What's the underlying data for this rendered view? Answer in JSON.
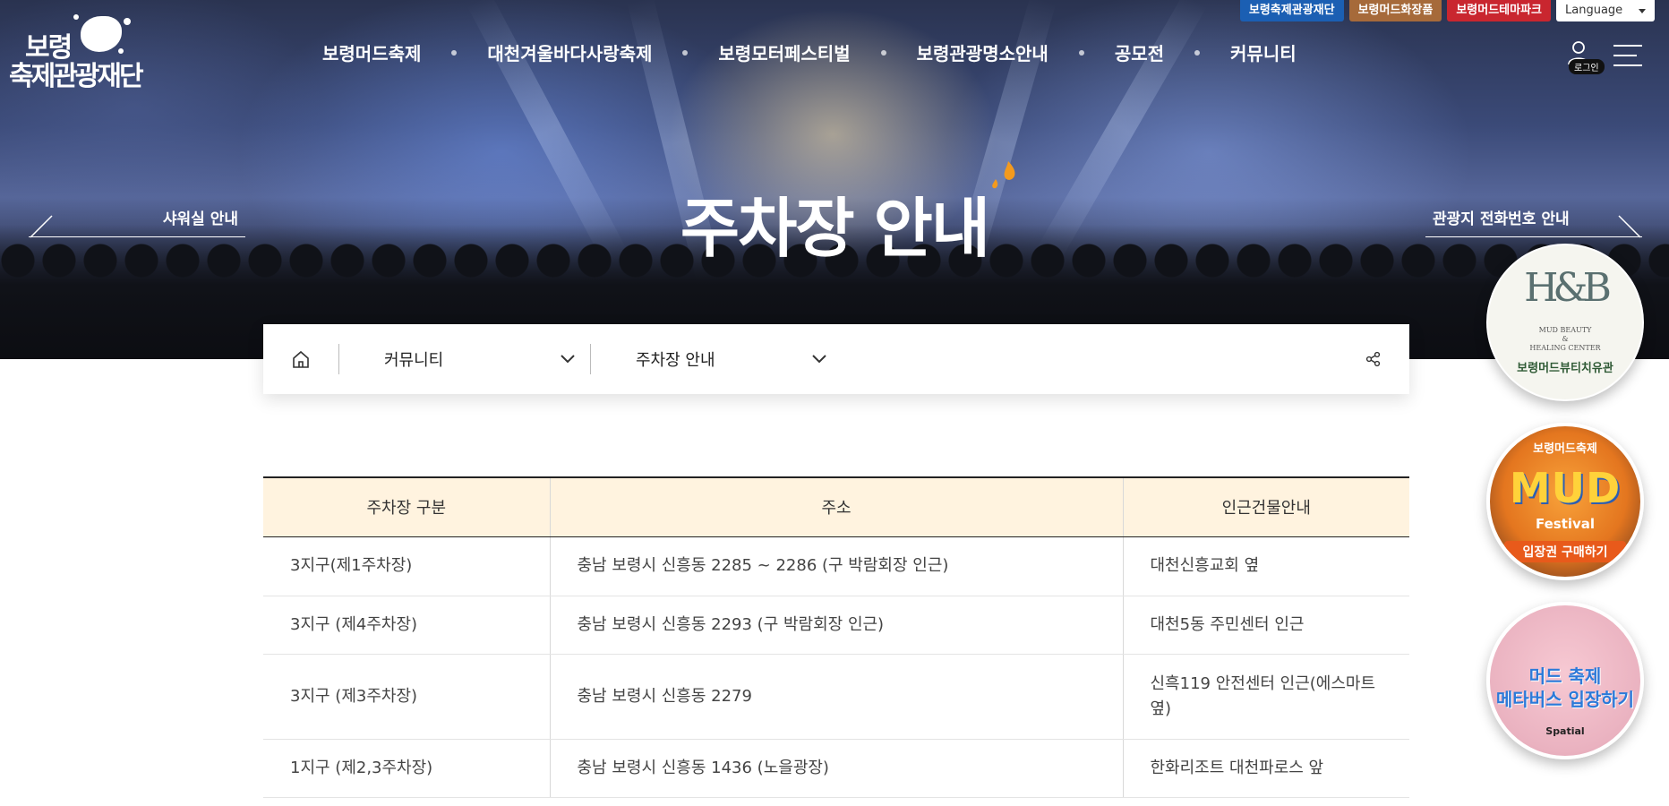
{
  "utility_links": [
    {
      "label": "보령축제관광재단",
      "color": "#1b5fb3"
    },
    {
      "label": "보령머드화장품",
      "color": "#a66a3a"
    },
    {
      "label": "보령머드테마파크",
      "color": "#c9262f"
    }
  ],
  "language": {
    "label": "Language"
  },
  "logo": {
    "line1": "보령",
    "line2": "축제관광재단"
  },
  "gnb": [
    "보령머드축제",
    "대천겨울바다사랑축제",
    "보령모터페스티벌",
    "보령관광명소안내",
    "공모전",
    "커뮤니티"
  ],
  "login_label": "로그인",
  "page_title": "주차장 안내",
  "prev_link": "샤워실 안내",
  "next_link": "관광지 전화번호 안내",
  "breadcrumb": {
    "depth1": "커뮤니티",
    "depth2": "주차장 안내"
  },
  "table": {
    "headers": [
      "주차장 구분",
      "주소",
      "인근건물안내"
    ],
    "rows": [
      [
        "3지구(제1주차장)",
        "충남 보령시 신흥동 2285 ~ 2286 (구 박람회장 인근)",
        "대천신흥교회 옆"
      ],
      [
        "3지구 (제4주차장)",
        "충남 보령시 신흥동 2293 (구 박람회장 인근)",
        "대천5동 주민센터 인근"
      ],
      [
        "3지구 (제3주차장)",
        "충남 보령시 신흥동 2279",
        "신흑119 안전센터 인근(에스마트 옆)"
      ],
      [
        "1지구 (제2,3주차장)",
        "충남 보령시 신흥동 1436 (노을광장)",
        "한화리조트 대천파로스 앞"
      ]
    ]
  },
  "banners": {
    "beauty": {
      "mono": "H&B",
      "sub1": "MUD BEAUTY",
      "sub2": "&",
      "sub3": "HEALING CENTER",
      "label": "보령머드뷰티치유관"
    },
    "festival": {
      "top": "보령머드축제",
      "big": "MUD",
      "mid": "Festival",
      "cta": "입장권 구매하기"
    },
    "metaverse": {
      "line1": "머드 축제",
      "line2": "메타버스 입장하기",
      "brand": "Spatial"
    }
  },
  "colors": {
    "accent": "#f39a1e",
    "table_header_bg": "#fff3df"
  }
}
